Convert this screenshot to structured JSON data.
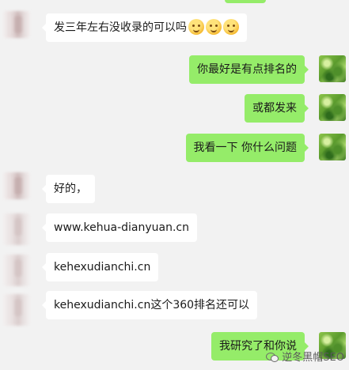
{
  "messages": [
    {
      "side": "left",
      "text": "发三年左右没收录的可以吗",
      "emoji_count": 3
    },
    {
      "side": "right",
      "text": "你最好是有点排名的"
    },
    {
      "side": "right",
      "text": "或都发来"
    },
    {
      "side": "right",
      "text": "我看一下 你什么问题"
    },
    {
      "side": "left",
      "text": "好的，"
    },
    {
      "side": "left",
      "text": "www.kehua-dianyuan.cn"
    },
    {
      "side": "left",
      "text": "kehexudianchi.cn"
    },
    {
      "side": "left",
      "text": "kehexudianchi.cn这个360排名还可以"
    },
    {
      "side": "right",
      "text": "我研究了和你说"
    }
  ],
  "watermark": {
    "text": "逆冬黑帽SEO"
  },
  "colors": {
    "background": "#f2f2f2",
    "incoming_bubble": "#ffffff",
    "outgoing_bubble": "#95ec69"
  },
  "icons": {
    "emoji": "thinking-face-emoji",
    "watermark": "wechat-channel-icon"
  }
}
